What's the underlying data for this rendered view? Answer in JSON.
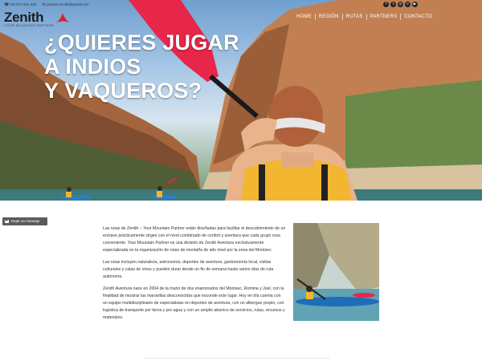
{
  "topbar": {
    "phone": "+34 670 661 425",
    "email": "partner.zenith@gmail.com",
    "phone_icon": "phone-icon",
    "email_icon": "envelope-icon",
    "social": [
      {
        "icon": "facebook-icon",
        "glyph": "f"
      },
      {
        "icon": "twitter-icon",
        "glyph": "t"
      },
      {
        "icon": "instagram-icon",
        "glyph": "◎"
      },
      {
        "icon": "tripadvisor-icon",
        "glyph": "∞"
      },
      {
        "icon": "youtube-icon",
        "glyph": "▶"
      }
    ]
  },
  "logo": {
    "name": "Zenith",
    "tagline": "YOUR MOUNTAIN PARTNER",
    "accent": "#d8232a"
  },
  "nav": [
    "HOME",
    "REGIÓN",
    "RUTAS",
    "PARTNERS",
    "CONTACTO"
  ],
  "hero": {
    "line1": "¿QUIERES JUGAR",
    "line2": "A INDIOS",
    "line3": "Y VAQUEROS?"
  },
  "message_button": "Dejar un mensaje",
  "content": {
    "p1": "Las rutas de Zenith – Your Mountain Partner están diseñadas para facilitar el descubrimiento de un enclave prácticamente virgen con el nivel combinado de confort y aventura que cada grupo crea conveniente. Your Mountain Partner es una división de Zenith Aventura exclusivamente especializada en la organización de rutas de montaña de alto nivel por la zona del Montsec.",
    "p2": "Las rutas incluyen naturaleza, astronomía, deportes de aventura, gastronomía local, visitas culturales y catas de vinos y pueden durar desde un fin de semana hasta varios días de ruta autónoma.",
    "p3": "Zenith Aventura nace en 2004 de la mano de dos enamorados del Montsec, Romina y Joel, con la finalidad de mostrar las maravillas desconocidas que esconde este lugar. Hoy en día cuenta con un equipo multidisciplinario de especialistas en deportes de aventura, con un albergue propio, con logística de transporte por tierra y por agua y con un amplio abanico de servicios, rutas, recursos y materiales."
  },
  "colors": {
    "paddle": "#e8264a",
    "lifejacket": "#f2b631",
    "kayak": "#2f7fc0"
  }
}
